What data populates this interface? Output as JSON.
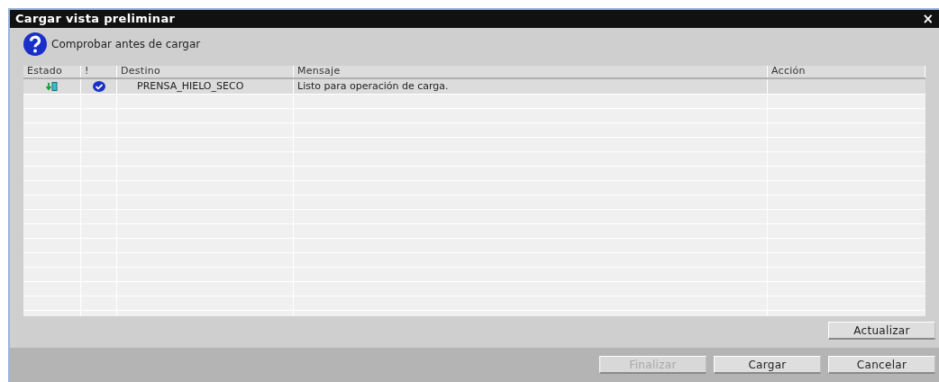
{
  "window": {
    "title": "Cargar vista preliminar",
    "close": "×"
  },
  "header": {
    "text": "Comprobar antes de cargar"
  },
  "table": {
    "columns": [
      "Estado",
      "!",
      "Destino",
      "Mensaje",
      "Acción"
    ],
    "rows": [
      {
        "destination": "PRENSA_HIELO_SECO",
        "message": "Listo para operación de carga.",
        "action": "",
        "selected": true
      }
    ]
  },
  "buttons": {
    "refresh": {
      "label": "Actualizar",
      "disabled": false
    },
    "footer": [
      {
        "label": "Finalizar",
        "disabled": true
      },
      {
        "label": "Cargar",
        "disabled": false
      },
      {
        "label": "Cancelar",
        "disabled": false
      }
    ]
  }
}
